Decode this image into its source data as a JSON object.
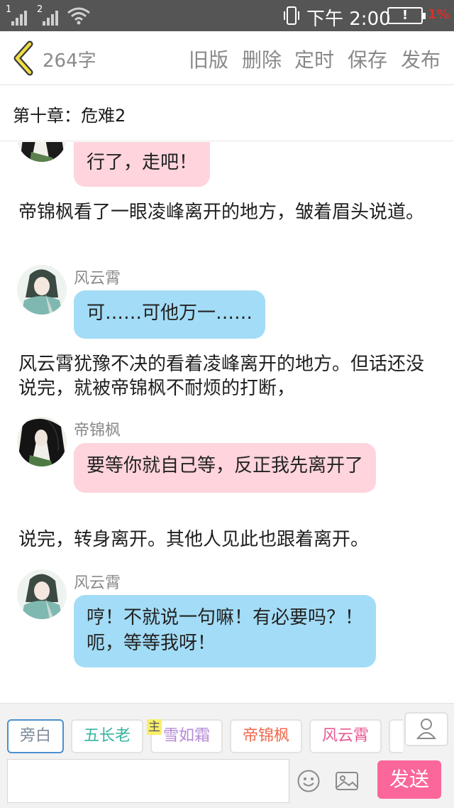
{
  "status_bar": {
    "sim1_label": "1",
    "sim2_label": "2",
    "time": "下午 2:00",
    "battery_symbol": "!",
    "battery_percent": "1%"
  },
  "toolbar": {
    "word_count": "264字",
    "old_version": "旧版",
    "delete": "删除",
    "schedule": "定时",
    "save": "保存",
    "publish": "发布"
  },
  "chapter": {
    "title": "第十章：危难2"
  },
  "story": {
    "msg_1": {
      "text": "行了，走吧！"
    },
    "narration_1": "帝锦枫看了一眼凌峰离开的地方，皱着眉头说道。",
    "msg_2": {
      "speaker": "风云霄",
      "text": "可……可他万一……"
    },
    "narration_2": "风云霄犹豫不决的看着凌峰离开的地方。但话还没说完，就被帝锦枫不耐烦的打断，",
    "msg_3": {
      "speaker": "帝锦枫",
      "text": "要等你就自己等，反正我先离开了"
    },
    "narration_3": "说完，转身离开。其他人见此也跟着离开。",
    "msg_4": {
      "speaker": "风云霄",
      "line1": "哼！不就说一句嘛！有必要吗？！",
      "line2": "呃，等等我呀！"
    }
  },
  "characters": [
    {
      "name": "旁白",
      "color": "#7c8a9a"
    },
    {
      "name": "五长老",
      "color": "#36b3a0"
    },
    {
      "name": "雪如霜",
      "color": "#b68ad6",
      "badge": "主"
    },
    {
      "name": "帝锦枫",
      "color": "#ef6a4e"
    },
    {
      "name": "风云霄",
      "color": "#e85a93"
    }
  ],
  "composer": {
    "input_value": "",
    "send_label": "发送"
  },
  "colors": {
    "accent_send": "#fb679a",
    "bubble_pink": "#ffd4dc",
    "bubble_blue": "#a3dcf6",
    "status_bar_bg": "#555555"
  }
}
